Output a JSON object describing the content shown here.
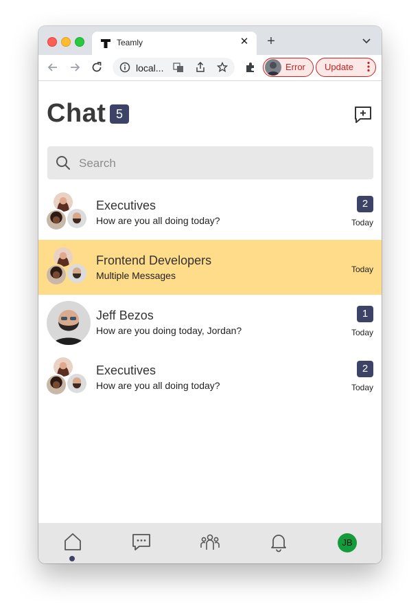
{
  "browser": {
    "tab_title": "Teamly",
    "address": "local...",
    "profile_label": "Error",
    "update_label": "Update"
  },
  "header": {
    "title": "Chat",
    "count": "5"
  },
  "search": {
    "placeholder": "Search"
  },
  "chats": [
    {
      "name": "Executives",
      "preview": "How are you all doing today?",
      "unread": "2",
      "time": "Today"
    },
    {
      "name": "Frontend Developers",
      "preview": "Multiple Messages",
      "unread": "",
      "time": "Today"
    },
    {
      "name": "Jeff Bezos",
      "preview": "How are you doing today, Jordan?",
      "unread": "1",
      "time": "Today"
    },
    {
      "name": "Executives",
      "preview": "How are you all doing today?",
      "unread": "2",
      "time": "Today"
    }
  ],
  "bottom_nav": {
    "items": [
      "home-icon",
      "chat-icon",
      "team-icon",
      "bell-icon"
    ],
    "user_initials": "JB"
  },
  "colors": {
    "accent": "#3d4366",
    "active_row": "#ffdc8a",
    "user_avatar": "#169b3c",
    "error": "#c5221f"
  }
}
